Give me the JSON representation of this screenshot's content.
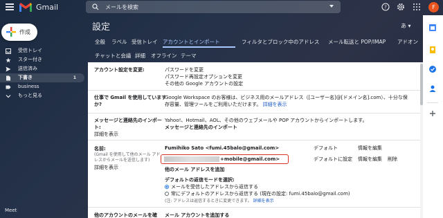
{
  "app": {
    "name": "Gmail"
  },
  "search": {
    "placeholder": "メールを検索"
  },
  "user": {
    "avatar_letter": "F"
  },
  "compose": {
    "label": "作成"
  },
  "nav": {
    "items": [
      {
        "label": "受信トレイ",
        "icon": "inbox-icon"
      },
      {
        "label": "スター付き",
        "icon": "star-icon"
      },
      {
        "label": "送信済み",
        "icon": "send-icon"
      },
      {
        "label": "下書き",
        "icon": "draft-icon",
        "count": "1"
      },
      {
        "label": "business",
        "icon": "label-icon"
      },
      {
        "label": "もっと見る",
        "icon": "chevron-down-icon"
      }
    ],
    "meet": "Meet"
  },
  "settings": {
    "title": "設定",
    "lang": "あ ▾",
    "tabs_row1": [
      "全般",
      "ラベル",
      "受信トレイ",
      "アカウントとインポート",
      "フィルタとブロック中のアドレス",
      "メール転送と POP/IMAP",
      "アドオン"
    ],
    "tabs_row2": [
      "チャットと会議",
      "詳細",
      "オフライン",
      "テーマ"
    ],
    "active_tab": "アカウントとインポート"
  },
  "sections": {
    "account": {
      "label": "アカウント設定を変更:",
      "links": [
        "パスワードを変更",
        "パスワード再設定オプションを変更",
        "その他の Google アカウントの設定"
      ]
    },
    "work": {
      "label": "仕事で Gmail を使用していますか?",
      "text1": "Google Workspace のお客様は、ビジネス用のメールアドレス（[ユーザー名]@[ドメイン名].com）、十分な保",
      "text2": "存容量、管理ツールをご利用いただけます。",
      "link": "詳細を表示"
    },
    "import": {
      "label": "メッセージと連絡先のインポート:",
      "detail_link": "詳細を表示",
      "text": "Yahoo!、Hotmail、AOL、その他のウェブメールや POP アカウントからインポートします。",
      "action_link": "メッセージと連絡先のインポート"
    },
    "name": {
      "label": "名前:",
      "hint1": "(Gmail を使用して他のメール アド",
      "hint2": "レスからメールを送信します)",
      "detail_link": "詳細を表示",
      "entry1": "Fumihiko Sato <fumi.45balo@gmail.com>",
      "entry1_status": "デフォルト",
      "entry1_edit": "情報を編集",
      "entry2": "+mobile@gmail.com>",
      "entry2_default": "デフォルトに設定",
      "entry2_edit": "情報を編集",
      "entry2_delete": "削除",
      "add_link": "他のメール アドレスを追加",
      "reply_mode_label": "デフォルトの返信モードを選択:",
      "radio1": "メールを受信したアドレスから返信する",
      "radio2": "常にデフォルトのアドレスから返信する (現在の設定: fumi.45balo@gmail.com)",
      "note": "(注: アドレスは返信するときに変更できます。",
      "note_link": "詳細を表示"
    },
    "check_other": {
      "label": "他のアカウントのメールを確",
      "link": "メール アカウントを追加する"
    }
  },
  "colors": {
    "accent": "#a8c7fa",
    "link": "#1a5bc9",
    "highlight_box": "#d93025"
  }
}
